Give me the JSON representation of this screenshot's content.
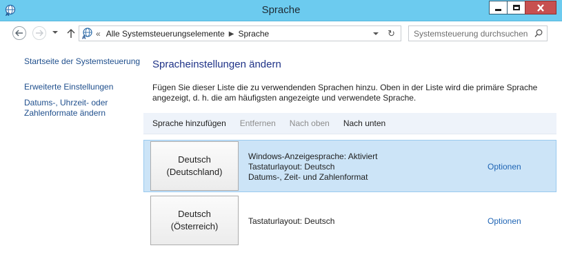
{
  "window": {
    "title": "Sprache"
  },
  "address_bar": {
    "overflow": "«",
    "crumbs": [
      "Alle Systemsteuerungselemente",
      "Sprache"
    ]
  },
  "search": {
    "placeholder": "Systemsteuerung durchsuchen"
  },
  "sidebar": {
    "items": [
      {
        "label": "Startseite der Systemsteuerung"
      },
      {
        "label": "Erweiterte Einstellungen"
      },
      {
        "label": "Datums-, Uhrzeit- oder Zahlenformate ändern"
      }
    ]
  },
  "main": {
    "title": "Spracheinstellungen ändern",
    "description": "Fügen Sie dieser Liste die zu verwendenden Sprachen hinzu. Oben in der Liste wird die primäre Sprache angezeigt, d. h. die am häufigsten angezeigte und verwendete Sprache."
  },
  "toolbar": {
    "add": "Sprache hinzufügen",
    "remove": "Entfernen",
    "up": "Nach oben",
    "down": "Nach unten"
  },
  "languages": [
    {
      "name_line1": "Deutsch",
      "name_line2": "(Deutschland)",
      "info": [
        "Windows-Anzeigesprache: Aktiviert",
        "Tastaturlayout: Deutsch",
        "Datums-, Zeit- und Zahlenformat"
      ],
      "options": "Optionen",
      "selected": true
    },
    {
      "name_line1": "Deutsch",
      "name_line2": "(Österreich)",
      "info": [
        "Tastaturlayout: Deutsch"
      ],
      "options": "Optionen",
      "selected": false
    }
  ],
  "colors": {
    "titlebar": "#6ccbef",
    "link": "#1e4e8c",
    "selection": "#cce4f7",
    "close": "#c75050"
  }
}
